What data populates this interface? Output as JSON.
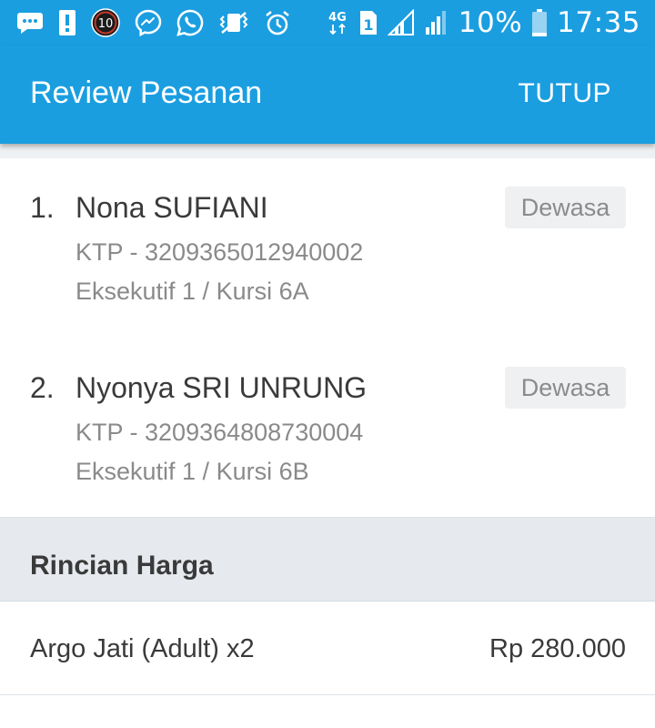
{
  "status_bar": {
    "notification_count": "10",
    "network_type": "4G",
    "sim_slot": "1",
    "battery": "10%",
    "time": "17:35",
    "icons": [
      "chat-icon",
      "alert-icon",
      "badge-10-icon",
      "messenger-icon",
      "whatsapp-icon",
      "vibrate-icon",
      "alarm-icon",
      "network-4g-icon",
      "sim-1-icon",
      "signal-icon",
      "signal-icon",
      "battery-icon"
    ]
  },
  "app_bar": {
    "title": "Review Pesanan",
    "action": "TUTUP"
  },
  "passengers": [
    {
      "number": "1.",
      "name": "Nona SUFIANI",
      "id_line": "KTP - 3209365012940002",
      "seat_line": "Eksekutif 1 / Kursi 6A",
      "type": "Dewasa"
    },
    {
      "number": "2.",
      "name": "Nyonya SRI UNRUNG",
      "id_line": "KTP - 3209364808730004",
      "seat_line": "Eksekutif 1 / Kursi 6B",
      "type": "Dewasa"
    }
  ],
  "price_details": {
    "title": "Rincian Harga",
    "items": [
      {
        "label": "Argo Jati (Adult) x2",
        "value": "Rp 280.000"
      }
    ]
  },
  "colors": {
    "primary": "#1b9ee0",
    "text_dark": "#3a3a3a",
    "text_muted": "#8a8a8a",
    "section_bg": "#e6eaee",
    "badge_bg": "#eef0f2"
  }
}
